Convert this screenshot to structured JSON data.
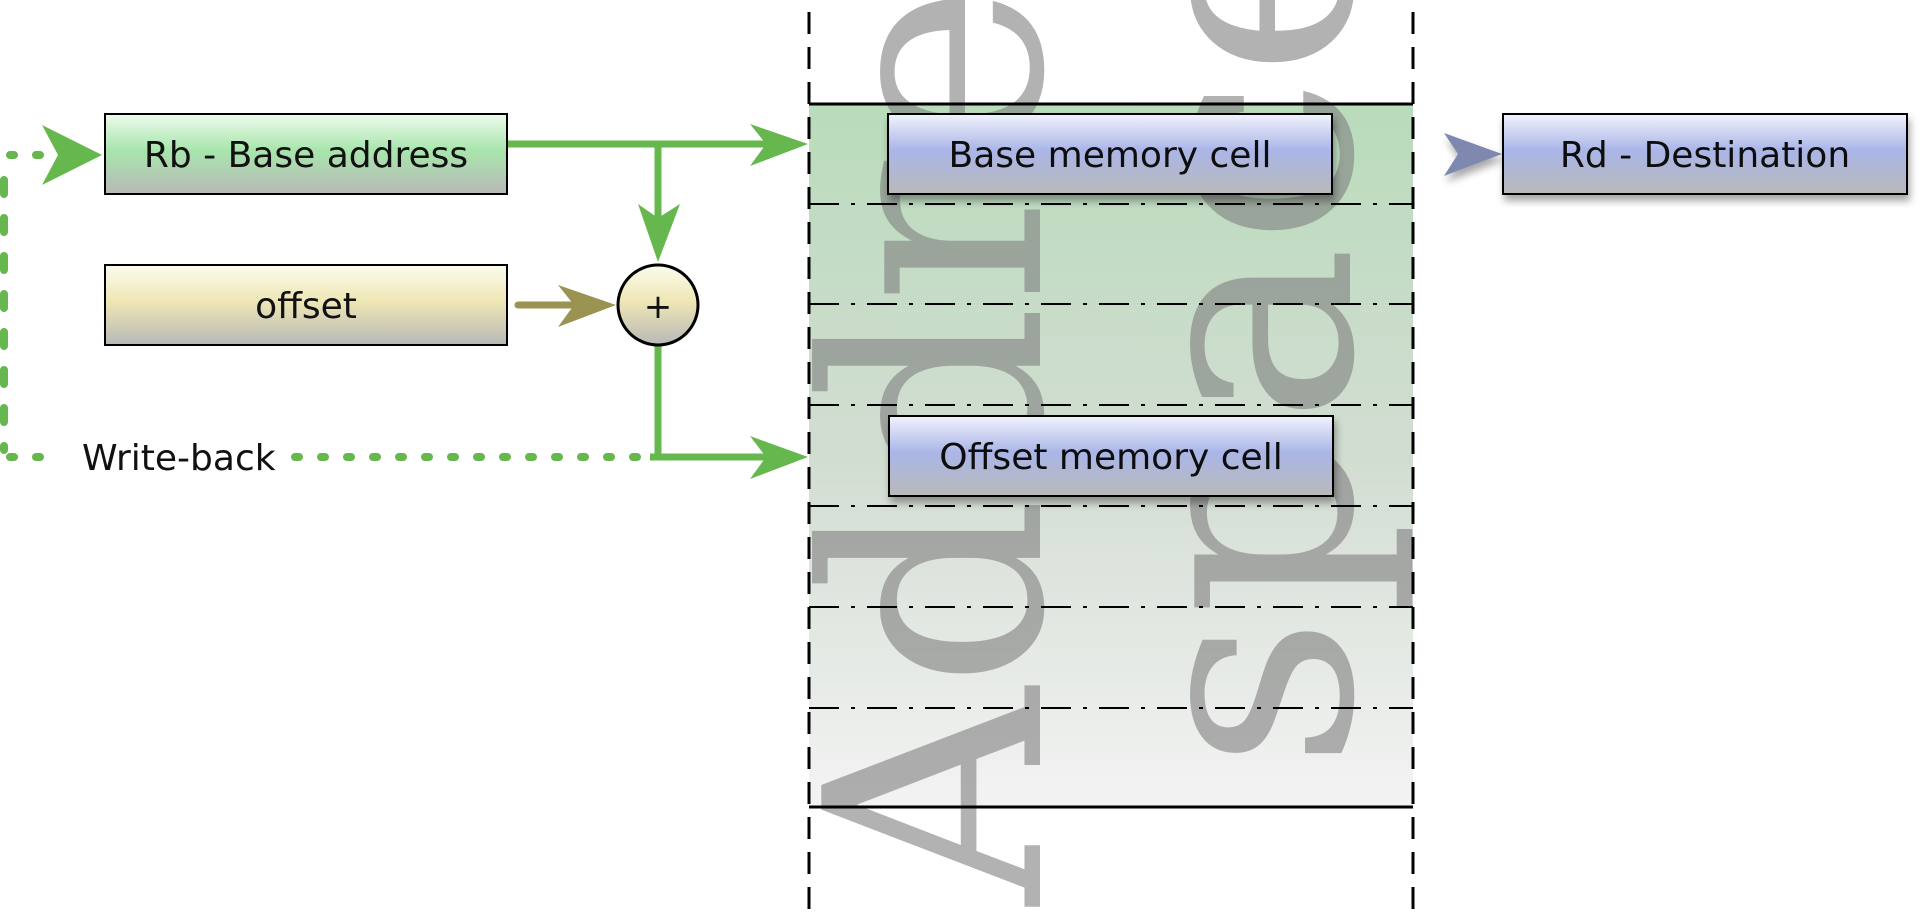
{
  "diagram": {
    "watermark": {
      "line1": "Address",
      "line2": "space"
    },
    "registers": {
      "base": {
        "label": "Rb - Base address"
      },
      "offset": {
        "label": "offset"
      },
      "destination": {
        "label": "Rd - Destination"
      }
    },
    "adder": {
      "symbol": "+"
    },
    "memory": {
      "base_cell": {
        "label": "Base memory cell"
      },
      "offset_cell": {
        "label": "Offset memory cell"
      }
    },
    "writeback": {
      "label": "Write-back"
    },
    "colors": {
      "green_arrow": "#66b84e",
      "olive_arrow": "#9a9352",
      "blue_arrow": "#7f89b0",
      "memory_fill_top": "#b9dcbb",
      "memory_fill_bottom": "#f3f3f3"
    }
  }
}
